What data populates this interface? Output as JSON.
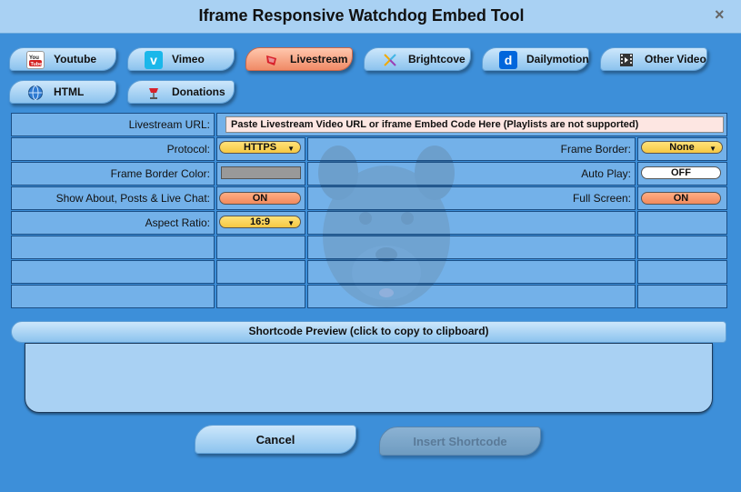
{
  "window": {
    "title": "Iframe Responsive Watchdog Embed Tool",
    "close_glyph": "×"
  },
  "tabs": [
    {
      "label": "Youtube",
      "icon": "youtube-icon",
      "active": false
    },
    {
      "label": "Vimeo",
      "icon": "vimeo-icon",
      "active": false
    },
    {
      "label": "Livestream",
      "icon": "livestream-icon",
      "active": true
    },
    {
      "label": "Brightcove",
      "icon": "brightcove-icon",
      "active": false
    },
    {
      "label": "Dailymotion",
      "icon": "dailymotion-icon",
      "active": false
    },
    {
      "label": "Other Video",
      "icon": "film-icon",
      "active": false
    },
    {
      "label": "HTML",
      "icon": "globe-icon",
      "active": false
    },
    {
      "label": "Donations",
      "icon": "donation-icon",
      "active": false
    }
  ],
  "form": {
    "url_label": "Livestream URL:",
    "url_value": "Paste Livestream Video URL or iframe Embed Code Here (Playlists are not supported)",
    "protocol_label": "Protocol:",
    "protocol_value": "HTTPS",
    "frame_border_label": "Frame Border:",
    "frame_border_value": "None",
    "frame_border_color_label": "Frame Border Color:",
    "frame_border_color_value": "#999999",
    "auto_play_label": "Auto Play:",
    "auto_play_value": "OFF",
    "show_about_label": "Show About, Posts & Live Chat:",
    "show_about_value": "ON",
    "full_screen_label": "Full Screen:",
    "full_screen_value": "ON",
    "aspect_ratio_label": "Aspect Ratio:",
    "aspect_ratio_value": "16:9"
  },
  "preview": {
    "header": "Shortcode Preview (click to copy to clipboard)",
    "content": ""
  },
  "buttons": {
    "cancel": "Cancel",
    "insert": "Insert Shortcode"
  },
  "colors": {
    "background": "#3d8fd9",
    "titlebar": "#a9d1f3",
    "active_tab": "#f08a66",
    "toggle_on": "#f28a5c",
    "dropdown": "#f5c842"
  }
}
